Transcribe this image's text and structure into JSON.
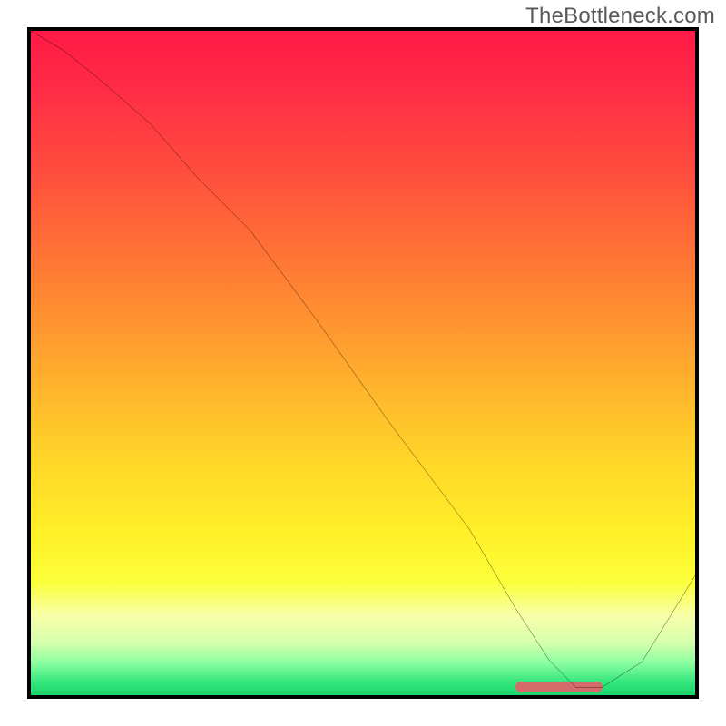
{
  "watermark": "TheBottleneck.com",
  "chart_data": {
    "type": "line",
    "title": "",
    "xlabel": "",
    "ylabel": "",
    "xlim": [
      0,
      100
    ],
    "ylim": [
      0,
      100
    ],
    "x": [
      0,
      5,
      10,
      18,
      25,
      33,
      43,
      54,
      66,
      73,
      78,
      82,
      86,
      92,
      100
    ],
    "values": [
      100,
      97,
      93,
      86,
      78,
      70,
      56.5,
      41,
      25,
      13,
      5.3,
      1.2,
      1.2,
      5,
      18
    ],
    "marker": {
      "x_start": 73,
      "x_end": 86,
      "y": 1.2
    },
    "colors": {
      "top": "#ff1a46",
      "mid": "#ffd928",
      "bottom": "#19d66c",
      "line": "#000000",
      "marker": "#d66b6b"
    }
  }
}
